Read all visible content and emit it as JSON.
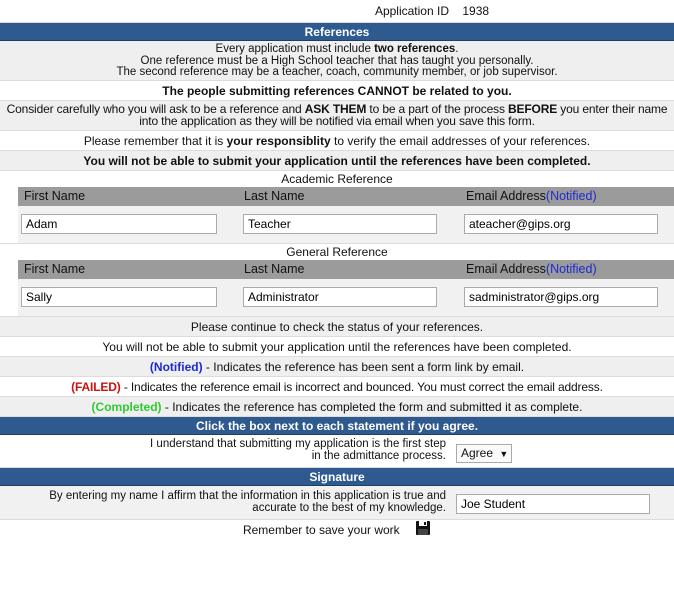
{
  "app_id": {
    "label": "Application ID",
    "value": "1938"
  },
  "references": {
    "header": "References",
    "intro": {
      "line1_prefix": "Every application must include ",
      "line1_bold": "two references",
      "line1_suffix": ".",
      "line2": "One reference must be a High School teacher that has taught you personally.",
      "line3": "The second reference may be a teacher, coach, community member, or job supervisor."
    },
    "not_related": "The people submitting references CANNOT be related to you.",
    "consider": {
      "p1": "Consider carefully who you will ask to be a reference and ",
      "b1": "ASK THEM",
      "p2": " to be a part of the process ",
      "b2": "BEFORE",
      "p3": " you enter their name",
      "line2": "into the application as they will be notified via email when you save this form."
    },
    "verify": {
      "p1": "Please remember that it is ",
      "b1": "your responsiblity",
      "p2": " to verify the email addresses of your references."
    },
    "cannot_submit": "You will not be able to submit your application until the references have been completed.",
    "columns": {
      "first": "First Name",
      "last": "Last Name",
      "email": "Email Address",
      "notified": "(Notified)"
    },
    "academic": {
      "title": "Academic Reference",
      "first": "Adam",
      "last": "Teacher",
      "email": "ateacher@gips.org"
    },
    "general": {
      "title": "General Reference",
      "first": "Sally",
      "last": "Administrator",
      "email": "sadministrator@gips.org"
    }
  },
  "status": {
    "continue": "Please continue to check the status of your references.",
    "cannot_submit": "You will not be able to submit your application until the references have been completed.",
    "notified_label": "(Notified)",
    "notified_text": " - Indicates the reference has been sent a form link by email.",
    "failed_label": "(FAILED)",
    "failed_text": " - Indicates the reference email is incorrect and bounced. You must correct the email address.",
    "completed_label": "(Completed)",
    "completed_text": " - Indicates the reference has completed the form and submitted it as complete."
  },
  "agreement": {
    "header": "Click the box next to each statement if you agree.",
    "line1": "I understand that submitting my application is the first step",
    "line2": "in the admittance process.",
    "selected": "Agree"
  },
  "signature": {
    "header": "Signature",
    "line1": "By entering my name I affirm that the information in this application is true and",
    "line2": "accurate to the best of my knowledge.",
    "value": "Joe Student"
  },
  "save": {
    "text": "Remember to save your work",
    "icon": "floppy-disk-icon"
  },
  "colors": {
    "header_bg": "#2e5a8f",
    "notified": "#1c2bd0",
    "failed": "#cc1111",
    "completed": "#2ecc2e"
  }
}
